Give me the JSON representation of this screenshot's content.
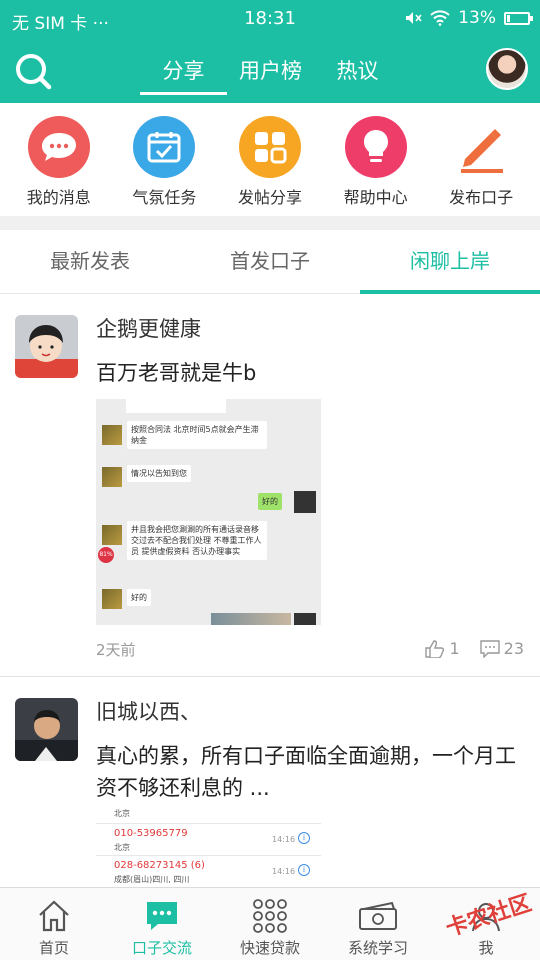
{
  "status_bar": {
    "carrier": "无 SIM 卡 ···",
    "time": "18:31",
    "battery": "13%",
    "battery_level": 0.13
  },
  "header": {
    "tabs": [
      {
        "label": "分享",
        "active": true
      },
      {
        "label": "用户榜",
        "active": false
      },
      {
        "label": "热议",
        "active": false
      }
    ]
  },
  "shortcuts": [
    {
      "label": "我的消息",
      "icon": "chat-bubble-icon",
      "color": "#ef5b5b"
    },
    {
      "label": "气氛任务",
      "icon": "calendar-check-icon",
      "color": "#3aa7e6"
    },
    {
      "label": "发帖分享",
      "icon": "grid-icon",
      "color": "#f6a623"
    },
    {
      "label": "帮助中心",
      "icon": "lightbulb-icon",
      "color": "#ef3d6a"
    },
    {
      "label": "发布口子",
      "icon": "pencil-icon",
      "color": "#ee6f3d"
    }
  ],
  "subtabs": [
    {
      "label": "最新发表",
      "active": false
    },
    {
      "label": "首发口子",
      "active": false
    },
    {
      "label": "闲聊上岸",
      "active": true
    }
  ],
  "posts": [
    {
      "author": "企鹅更健康",
      "text": "百万老哥就是牛b",
      "time": "2天前",
      "likes": "1",
      "comments": "23",
      "image": {
        "msgs": [
          "按照合同法 北京时间5点就会产生滞纳金",
          "情况以告知到您",
          "好的",
          "并且我会把您涮涮的所有通话录音移交过去不配合我们处理 不尊重工作人员 提供虚假资料 否认办理事实",
          "好的"
        ],
        "badge": "81%"
      }
    },
    {
      "author": "旧城以西、",
      "text": "真心的累，所有口子面临全面逾期，一个月工资不够还利息的 ...",
      "image": {
        "rows": [
          {
            "number": "",
            "place": "北京",
            "time": ""
          },
          {
            "number": "010-53965779",
            "place": "北京",
            "time": "14:16"
          },
          {
            "number": "028-68273145 (6)",
            "place": "成都(眉山)四川, 四川",
            "time": "14:16"
          }
        ]
      }
    }
  ],
  "bottom_nav": [
    {
      "label": "首页",
      "icon": "home-icon",
      "active": false
    },
    {
      "label": "口子交流",
      "icon": "chat-icon",
      "active": true
    },
    {
      "label": "快速贷款",
      "icon": "dots-grid-icon",
      "active": false
    },
    {
      "label": "系统学习",
      "icon": "money-icon",
      "active": false
    },
    {
      "label": "我",
      "icon": "user-icon",
      "active": false
    }
  ],
  "watermark": "卡农社区",
  "colors": {
    "accent": "#1cbfa3"
  }
}
